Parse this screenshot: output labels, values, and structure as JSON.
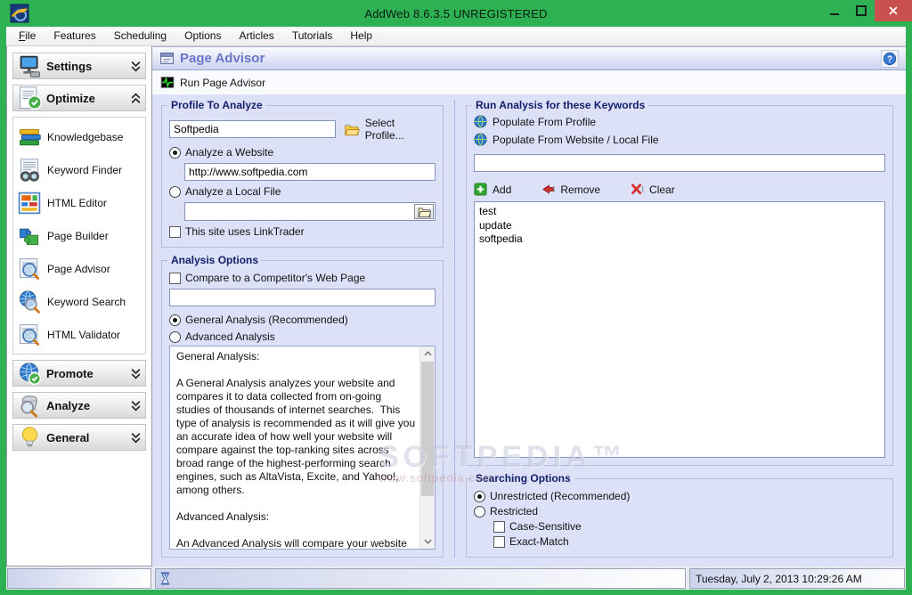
{
  "window": {
    "title": "AddWeb 8.6.3.5  UNREGISTERED"
  },
  "menu": {
    "items": [
      {
        "label": "File"
      },
      {
        "label": "Features"
      },
      {
        "label": "Scheduling"
      },
      {
        "label": "Options"
      },
      {
        "label": "Articles"
      },
      {
        "label": "Tutorials"
      },
      {
        "label": "Help"
      }
    ]
  },
  "sidebar": {
    "settings": {
      "label": "Settings"
    },
    "optimize": {
      "label": "Optimize"
    },
    "promote": {
      "label": "Promote"
    },
    "analyze": {
      "label": "Analyze"
    },
    "general": {
      "label": "General"
    },
    "optimize_items": [
      {
        "label": "Knowledgebase"
      },
      {
        "label": "Keyword Finder"
      },
      {
        "label": "HTML Editor"
      },
      {
        "label": "Page Builder"
      },
      {
        "label": "Page Advisor"
      },
      {
        "label": "Keyword Search"
      },
      {
        "label": "HTML Validator"
      }
    ]
  },
  "page_header": {
    "title": "Page Advisor"
  },
  "toolbar": {
    "run_label": "Run Page Advisor"
  },
  "profile_group": {
    "title": "Profile To Analyze",
    "profile_name": "Softpedia",
    "select_profile_label": "Select Profile...",
    "analyze_website_label": "Analyze a Website",
    "website_url": "http://www.softpedia.com",
    "analyze_local_label": "Analyze a Local File",
    "local_file_path": "",
    "linktrader_label": "This site uses LinkTrader"
  },
  "analysis_group": {
    "title": "Analysis Options",
    "compare_label": "Compare to a Competitor's Web Page",
    "competitor_url": "",
    "general_label": "General Analysis (Recommended)",
    "advanced_label": "Advanced Analysis",
    "description": "General Analysis:\n\nA General Analysis analyzes your website and compares it to data collected from on-going studies of thousands of internet searches.  This type of analysis is recommended as it will give you an accurate idea of how well your website will compare against the top-ranking sites across broad range of the highest-performing search engines, such as AltaVista, Excite, and Yahoo!, among others.\n\nAdvanced Analysis:\n\nAn Advanced Analysis will compare your website against the highest ranked listings for one particular search engine. Because this data is retrieved  directly from the search engine's results, it may take some time.  It will also give you a much more narrow perspective regarding the quality of your website since it is compared against the listings of only one search engine."
  },
  "keywords_group": {
    "title": "Run Analysis for these Keywords",
    "populate_profile_label": "Populate From Profile",
    "populate_website_label": "Populate From Website / Local File",
    "keyword_input": "",
    "add_label": "Add",
    "remove_label": "Remove",
    "clear_label": "Clear",
    "items": [
      "test",
      "update",
      "softpedia"
    ]
  },
  "searching_group": {
    "title": "Searching Options",
    "unrestricted_label": "Unrestricted (Recommended)",
    "restricted_label": "Restricted",
    "case_sensitive_label": "Case-Sensitive",
    "exact_match_label": "Exact-Match"
  },
  "statusbar": {
    "datetime": "Tuesday, July 2, 2013 10:29:26 AM"
  },
  "watermark": {
    "line1": "SOFTPEDIA™",
    "line2": "www.softpedia.com"
  },
  "colors": {
    "titlebar_green": "#2eb153",
    "close_red": "#c9504e",
    "header_text": "#6b76ca",
    "content_bg": "#dce1f7",
    "group_title": "#14206a"
  }
}
